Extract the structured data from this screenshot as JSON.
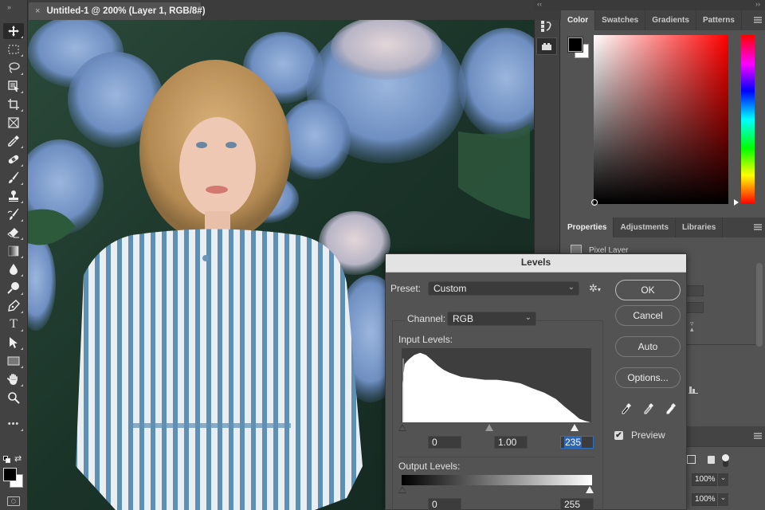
{
  "app": {
    "panel_collapse_left": "»",
    "document_tab": {
      "close": "×",
      "title": "Untitled-1 @ 200% (Layer 1, RGB/8#)"
    }
  },
  "toolbar": {
    "tools": [
      {
        "name": "move-tool",
        "active": true
      },
      {
        "name": "rectangular-marquee-tool"
      },
      {
        "name": "lasso-tool"
      },
      {
        "name": "object-selection-tool"
      },
      {
        "name": "crop-tool"
      },
      {
        "name": "frame-tool"
      },
      {
        "name": "eyedropper-tool"
      },
      {
        "name": "spot-healing-brush-tool"
      },
      {
        "name": "brush-tool"
      },
      {
        "name": "clone-stamp-tool"
      },
      {
        "name": "history-brush-tool"
      },
      {
        "name": "eraser-tool"
      },
      {
        "name": "gradient-tool"
      },
      {
        "name": "blur-tool"
      },
      {
        "name": "dodge-tool"
      },
      {
        "name": "pen-tool"
      },
      {
        "name": "type-tool",
        "glyph": "T"
      },
      {
        "name": "path-selection-tool"
      },
      {
        "name": "rectangle-tool"
      },
      {
        "name": "hand-tool"
      },
      {
        "name": "zoom-tool"
      },
      {
        "name": "edit-toolbar",
        "glyph": "•••"
      }
    ],
    "foreground_color": "#000000",
    "background_color": "#ffffff"
  },
  "dock": {
    "collapse_left": "‹‹",
    "collapse_right": "››",
    "buttons": [
      "history-icon",
      "plugins-icon"
    ]
  },
  "color_panel": {
    "tabs": [
      "Color",
      "Swatches",
      "Gradients",
      "Patterns"
    ],
    "active_tab": "Color",
    "foreground": "#000000",
    "background": "#ffffff",
    "hue": "#ff0000"
  },
  "properties_panel": {
    "tabs": [
      "Properties",
      "Adjustments",
      "Libraries"
    ],
    "active_tab": "Properties",
    "layer_type": "Pixel Layer"
  },
  "layers_panel": {
    "opacity": "100%",
    "fill": "100%",
    "dropdown_chevron": "⌄"
  },
  "levels_dialog": {
    "title": "Levels",
    "preset_label": "Preset:",
    "preset_value": "Custom",
    "channel_label": "Channel:",
    "channel_value": "RGB",
    "input_levels_label": "Input Levels:",
    "input_black": "0",
    "input_gamma": "1.00",
    "input_white": "235",
    "output_levels_label": "Output Levels:",
    "output_black": "0",
    "output_white": "255",
    "buttons": {
      "ok": "OK",
      "cancel": "Cancel",
      "auto": "Auto",
      "options": "Options..."
    },
    "preview_label": "Preview",
    "preview_checked": true,
    "chevron": "⌄",
    "checkmark": "✔",
    "gear": "✲",
    "gear_caret": "▾"
  },
  "chart_data": {
    "type": "area",
    "title": "Input Levels histogram (RGB)",
    "x_range": [
      0,
      255
    ],
    "y_range": [
      0,
      1
    ],
    "x": [
      0,
      3,
      6,
      10,
      16,
      24,
      32,
      40,
      48,
      56,
      64,
      72,
      80,
      96,
      112,
      128,
      144,
      160,
      176,
      192,
      208,
      220,
      232,
      240,
      248,
      255
    ],
    "values": [
      0.55,
      0.82,
      0.86,
      0.9,
      0.95,
      0.98,
      0.95,
      0.88,
      0.8,
      0.74,
      0.7,
      0.67,
      0.64,
      0.62,
      0.6,
      0.6,
      0.58,
      0.55,
      0.48,
      0.42,
      0.33,
      0.22,
      0.12,
      0.05,
      0.02,
      0.0
    ]
  }
}
